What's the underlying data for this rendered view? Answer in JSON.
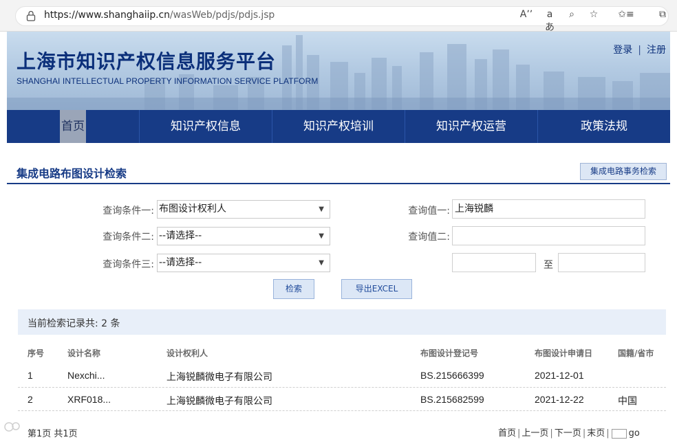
{
  "browser": {
    "url_host": "https://www.shanghaiip.cn",
    "url_path": "/wasWeb/pdjs/pdjs.jsp",
    "icons": [
      "lock-icon",
      "read-aloud-icon",
      "translate-icon",
      "zoom-icon",
      "favorite-add-icon",
      "favorites-icon",
      "collections-icon"
    ],
    "icon_glyphs": [
      "Aʼʼ",
      "aあ",
      "⌕",
      "☆",
      "✩≡",
      "⧉"
    ]
  },
  "header": {
    "title": "上海市知识产权信息服务平台",
    "subtitle": "SHANGHAI INTELLECTUAL PROPERTY INFORMATION SERVICE PLATFORM",
    "login": "登录",
    "separator": "|",
    "register": "注册"
  },
  "nav": {
    "items": [
      {
        "label": "首页",
        "active": true
      },
      {
        "label": "知识产权信息"
      },
      {
        "label": "知识产权培训"
      },
      {
        "label": "知识产权运营"
      },
      {
        "label": "政策法规"
      }
    ]
  },
  "section": {
    "title": "集成电路布图设计检索",
    "affairs_button": "集成电路事务检索"
  },
  "form": {
    "condition1_label": "查询条件一:",
    "condition1_value": "布图设计权利人",
    "condition2_label": "查询条件二:",
    "condition2_value": "--请选择--",
    "condition3_label": "查询条件三:",
    "condition3_value": "--请选择--",
    "value1_label": "查询值一:",
    "value1": "上海锐麟",
    "value2_label": "查询值二:",
    "value2": "",
    "range_from": "",
    "range_sep": "至",
    "range_to": "",
    "search_button": "检索",
    "export_button": "导出EXCEL"
  },
  "results": {
    "summary": "当前检索记录共: 2 条",
    "columns": [
      "序号",
      "设计名称",
      "设计权利人",
      "布图设计登记号",
      "布图设计申请日",
      "国籍/省市"
    ],
    "rows": [
      [
        "1",
        "Nexchi...",
        "上海锐麟微电子有限公司",
        "BS.215666399",
        "2021-12-01",
        ""
      ],
      [
        "2",
        "XRF018...",
        "上海锐麟微电子有限公司",
        "BS.215682599",
        "2021-12-22",
        "中国"
      ]
    ]
  },
  "pagination": {
    "info": "第1页 共1页",
    "first": "首页",
    "prev": "上一页",
    "next": "下一页",
    "last": "末页",
    "sep": "|",
    "go": "go"
  },
  "colors": {
    "brand_navy": "#173b86",
    "banner_sky": "#b4cbe3",
    "button_bg": "#dce7f6",
    "result_bar": "#e8eff9"
  }
}
